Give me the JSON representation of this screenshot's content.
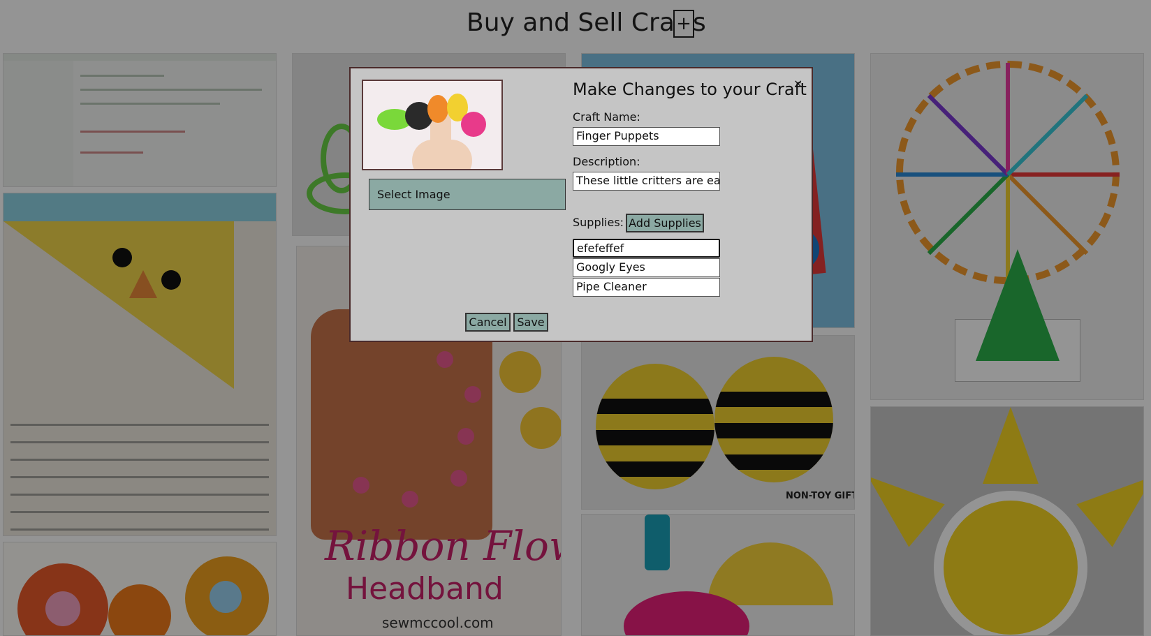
{
  "header": {
    "title": "Buy and Sell Crafts",
    "add_label": "+"
  },
  "gallery": {
    "tiles": [
      {
        "name": "screenshot"
      },
      {
        "name": "chick-bookmark"
      },
      {
        "name": "felt-flowers"
      },
      {
        "name": "pipe-cleaner-flower"
      },
      {
        "name": "ribbon-flower-headband"
      },
      {
        "name": "red-paper-craft"
      },
      {
        "name": "paper-plate-bees"
      },
      {
        "name": "paper-plate-dinosaur"
      },
      {
        "name": "straw-ferris-wheel"
      },
      {
        "name": "paper-plate-sun"
      }
    ],
    "ribbon_caption_line1": "Ribbon Flower",
    "ribbon_caption_line2": "Headband",
    "ribbon_caption_line3": "sewmccool.com",
    "bees_label": "NON-TOY GIFTS"
  },
  "modal": {
    "title": "Make Changes to your Craft",
    "close_label": "×",
    "select_image_label": "Select Image",
    "craft_name_label": "Craft Name:",
    "craft_name_value": "Finger Puppets",
    "description_label": "Description:",
    "description_value": "These little critters are eas",
    "supplies_label": "Supplies:",
    "add_supplies_label": "Add Supplies",
    "supplies": [
      "efefeffef",
      "Googly Eyes",
      "Pipe Cleaner"
    ],
    "cancel_label": "Cancel",
    "save_label": "Save",
    "accent_color": "#8ba9a3"
  }
}
